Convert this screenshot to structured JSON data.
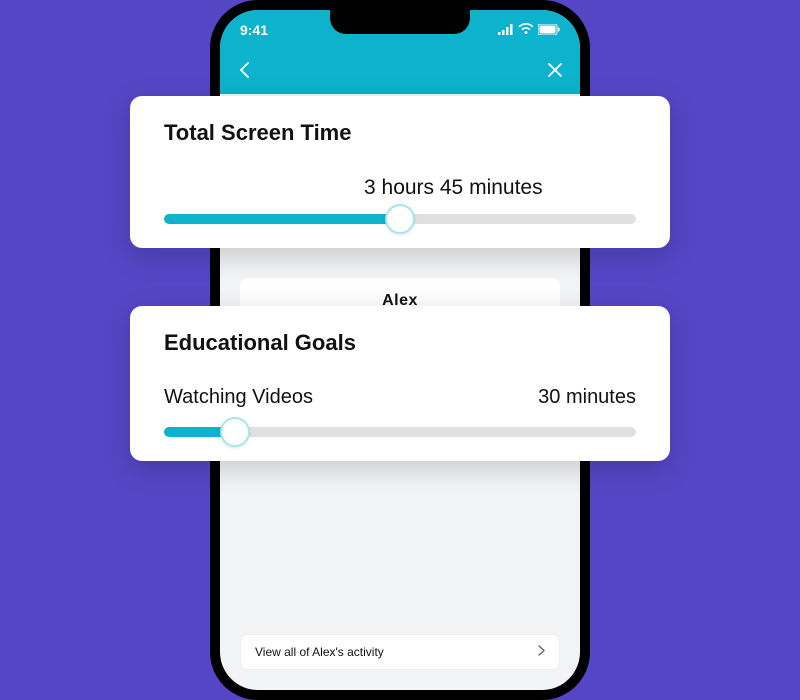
{
  "status": {
    "time": "9:41"
  },
  "phone": {
    "child_name": "Alex",
    "activity_link": "View all of Alex's activity"
  },
  "cards": {
    "screen_time": {
      "title": "Total Screen Time",
      "value_label": "3 hours 45 minutes",
      "percent": 50
    },
    "educational": {
      "title": "Educational Goals",
      "subcategory": "Watching Videos",
      "value_label": "30 minutes",
      "percent": 15
    }
  },
  "colors": {
    "accent": "#0db3cc",
    "bg": "#5546c6"
  }
}
